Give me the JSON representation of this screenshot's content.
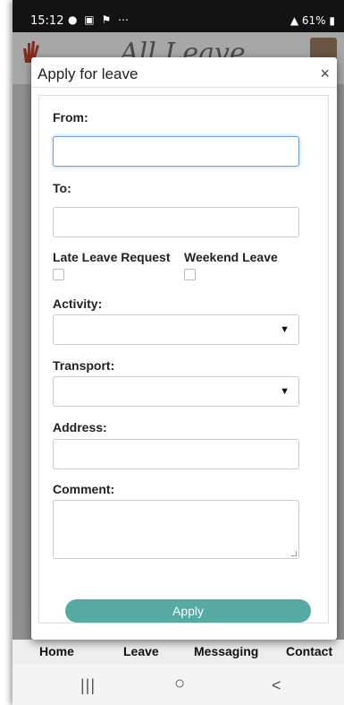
{
  "status_bar": {
    "time": "15:12",
    "left_icons": "● ▣ ⚑ ⋯",
    "right_text": "61%"
  },
  "app": {
    "logo_text": "All Leave"
  },
  "modal": {
    "title": "Apply for leave",
    "close_label": "×",
    "from_label": "From:",
    "from_value": "",
    "to_label": "To:",
    "to_value": "",
    "late_leave_label": "Late Leave Request",
    "weekend_leave_label": "Weekend Leave",
    "activity_label": "Activity:",
    "activity_value": "",
    "transport_label": "Transport:",
    "transport_value": "",
    "address_label": "Address:",
    "address_value": "",
    "comment_label": "Comment:",
    "comment_value": "",
    "apply_label": "Apply"
  },
  "bottom_nav": [
    {
      "label": "Home"
    },
    {
      "label": "Leave"
    },
    {
      "label": "Messaging"
    },
    {
      "label": "Contact"
    }
  ],
  "system_nav": {
    "recent": "|||",
    "home": "○",
    "back": "<"
  },
  "colors": {
    "accent": "#57a9a4",
    "status_bar": "#131313",
    "overlay": "#8f8f8f"
  }
}
